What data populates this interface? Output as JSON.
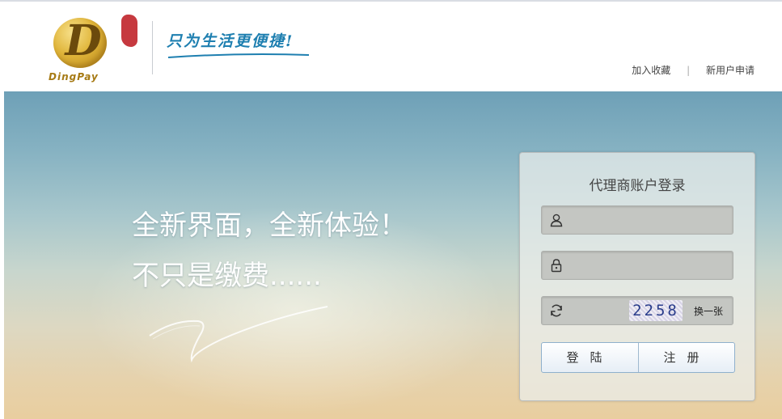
{
  "header": {
    "logo_text": "DingPay",
    "slogan": "只为生活更便捷!",
    "links": {
      "favorite": "加入收藏",
      "separator": "|",
      "apply": "新用户申请"
    }
  },
  "hero": {
    "line1": "全新界面，全新体验！",
    "line2": "不只是缴费......"
  },
  "login": {
    "title": "代理商账户登录",
    "username_value": "",
    "password_value": "",
    "captcha_input_value": "",
    "captcha_image_text": "2258",
    "captcha_refresh_label": "换一张",
    "login_button": "登陆",
    "register_button": "注册"
  },
  "colors": {
    "brand_gold": "#d4a52a",
    "slogan_blue": "#1e7fb0",
    "button_border": "#8fb0cc"
  }
}
